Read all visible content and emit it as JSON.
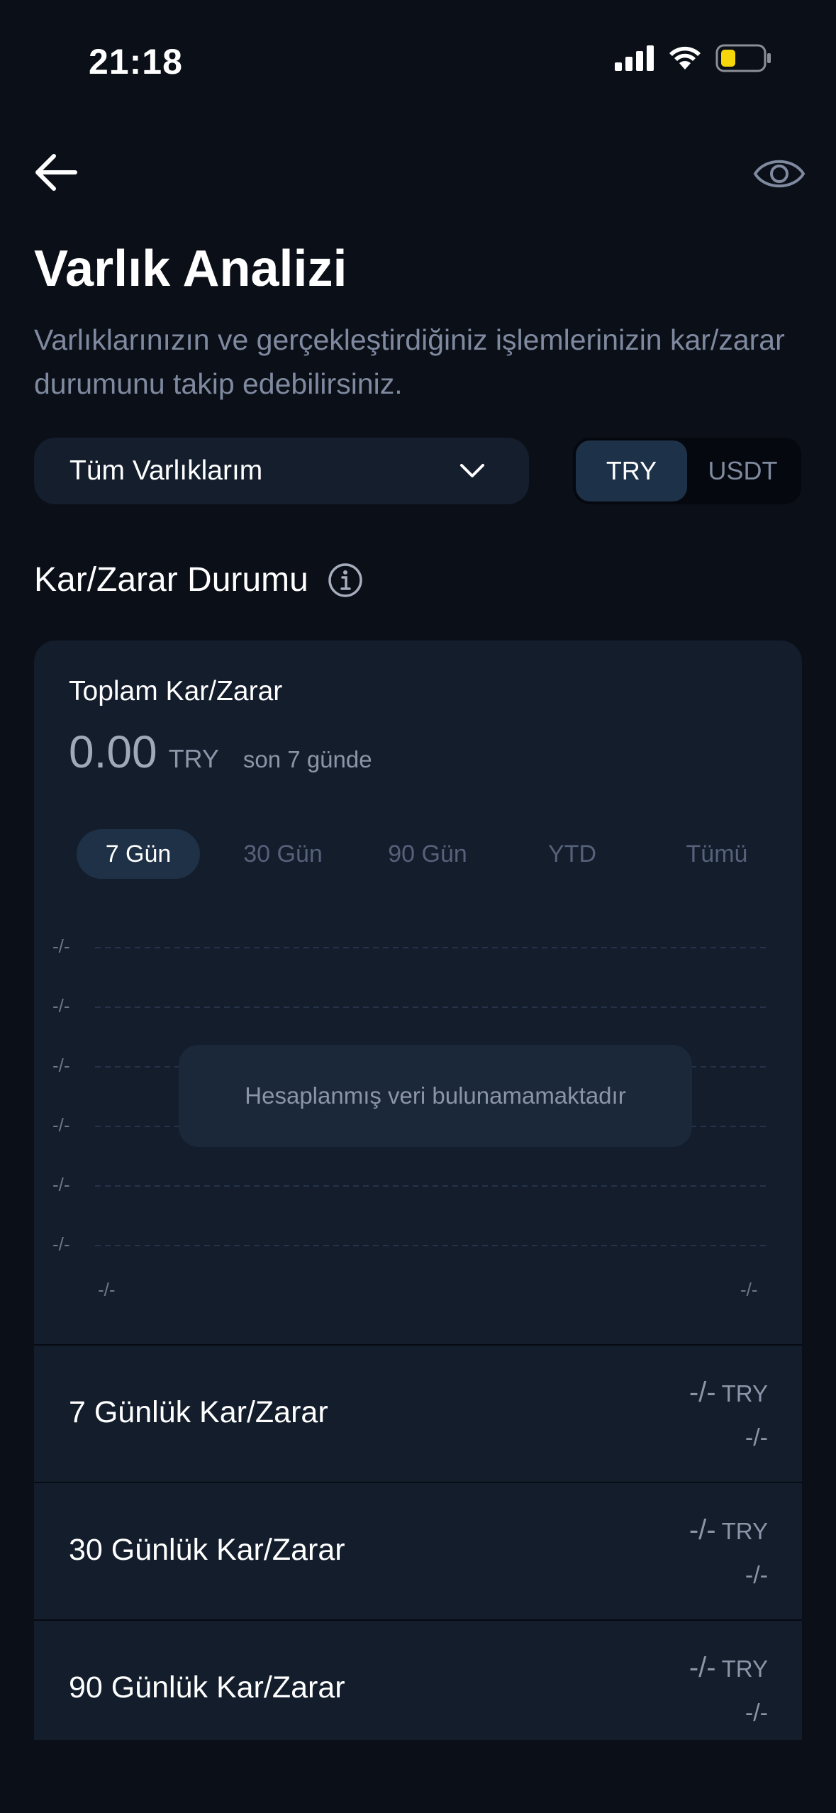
{
  "status_bar": {
    "time": "21:18"
  },
  "header": {
    "title": "Varlık Analizi",
    "subtitle": "Varlıklarınızın ve gerçekleştirdiğiniz işlemlerinizin kar/zarar durumunu takip edebilirsiniz."
  },
  "asset_select": {
    "value": "Tüm Varlıklarım"
  },
  "currency_toggle": {
    "options": [
      "TRY",
      "USDT"
    ],
    "selected": "TRY"
  },
  "section": {
    "title": "Kar/Zarar Durumu"
  },
  "summary": {
    "label": "Toplam Kar/Zarar",
    "value": "0.00",
    "currency": "TRY",
    "period": "son 7 günde"
  },
  "range_tabs": [
    "7 Gün",
    "30 Gün",
    "90 Gün",
    "YTD",
    "Tümü"
  ],
  "chart": {
    "y_labels": [
      "-/-",
      "-/-",
      "-/-",
      "-/-",
      "-/-",
      "-/-"
    ],
    "x_labels": [
      "-/-",
      "-/-"
    ],
    "empty_message": "Hesaplanmış veri bulunamamaktadır"
  },
  "rows": [
    {
      "label": "7 Günlük Kar/Zarar",
      "value": "-/-",
      "currency": "TRY",
      "sub": "-/-"
    },
    {
      "label": "30 Günlük Kar/Zarar",
      "value": "-/-",
      "currency": "TRY",
      "sub": "-/-"
    },
    {
      "label": "90 Günlük Kar/Zarar",
      "value": "-/-",
      "currency": "TRY",
      "sub": "-/-"
    }
  ],
  "colors": {
    "background": "#0b0f17",
    "card": "#131d2c",
    "accent": "#1d3148",
    "battery": "#f5d60a"
  }
}
